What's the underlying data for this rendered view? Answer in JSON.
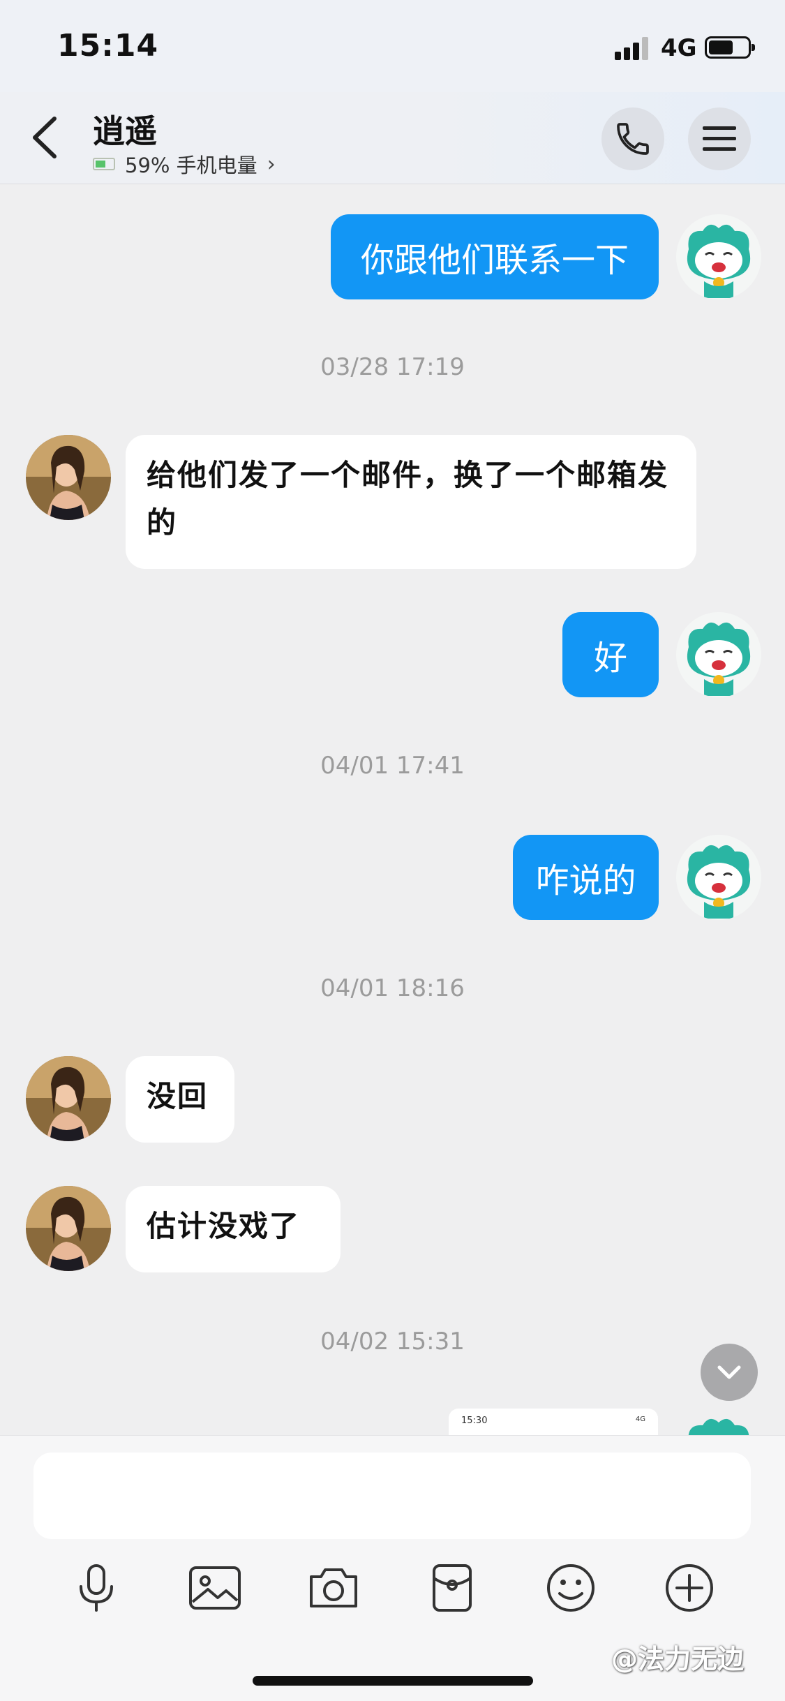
{
  "status_bar": {
    "time": "15:14",
    "network": "4G"
  },
  "header": {
    "contact_name": "逍遥",
    "battery_text": "59% 手机电量",
    "chevron": "›"
  },
  "messages": [
    {
      "side": "me",
      "text": "你跟他们联系一下"
    },
    {
      "type": "timestamp",
      "text": "03/28 17:19"
    },
    {
      "side": "her",
      "text": "给他们发了一个邮件，换了一个邮箱发的"
    },
    {
      "side": "me",
      "text": "好"
    },
    {
      "type": "timestamp",
      "text": "04/01 17:41"
    },
    {
      "side": "me",
      "text": "咋说的"
    },
    {
      "type": "timestamp",
      "text": "04/01 18:16"
    },
    {
      "side": "her",
      "text": "没回"
    },
    {
      "side": "her",
      "text": "估计没戏了"
    },
    {
      "type": "timestamp",
      "text": "04/02 15:31"
    }
  ],
  "preview_image": {
    "time": "15:30",
    "net": "4G"
  },
  "toolbar": {
    "icons": [
      "microphone-icon",
      "image-icon",
      "camera-icon",
      "red-packet-icon",
      "emoji-icon",
      "plus-icon"
    ]
  },
  "watermark": "@法力无边",
  "colors": {
    "my_bubble": "#1296f5",
    "her_bubble": "#ffffff",
    "background": "#efeff0"
  }
}
